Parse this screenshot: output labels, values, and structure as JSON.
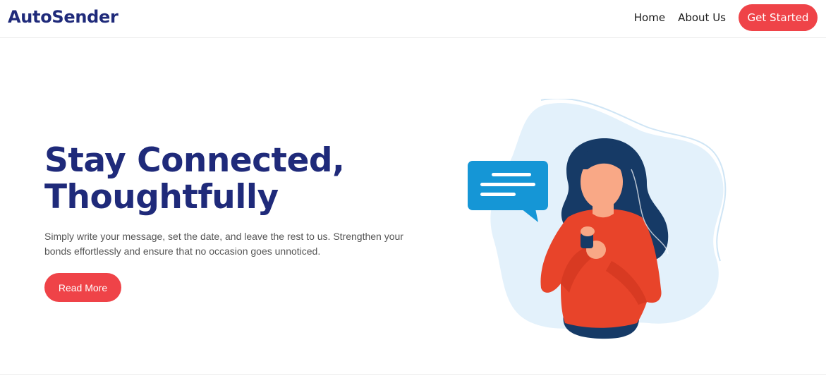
{
  "brand": {
    "name": "AutoSender"
  },
  "nav": {
    "home": "Home",
    "about": "About Us",
    "cta": "Get Started"
  },
  "hero": {
    "title_line1": "Stay Connected,",
    "title_line2": "Thoughtfully",
    "description": "Simply write your message, set the date, and leave the rest to us. Strengthen your bonds effortlessly and ensure that no occasion goes unnoticed.",
    "button": "Read More"
  },
  "illustration": {
    "icon": "woman-with-phone-and-chat-bubble"
  },
  "colors": {
    "brand": "#1f2a7a",
    "accent": "#ef4348",
    "bubble": "#1596d6",
    "blob": "#e3f1fb",
    "shirt": "#e8442a",
    "hair": "#163a66",
    "skin": "#f9a886"
  }
}
